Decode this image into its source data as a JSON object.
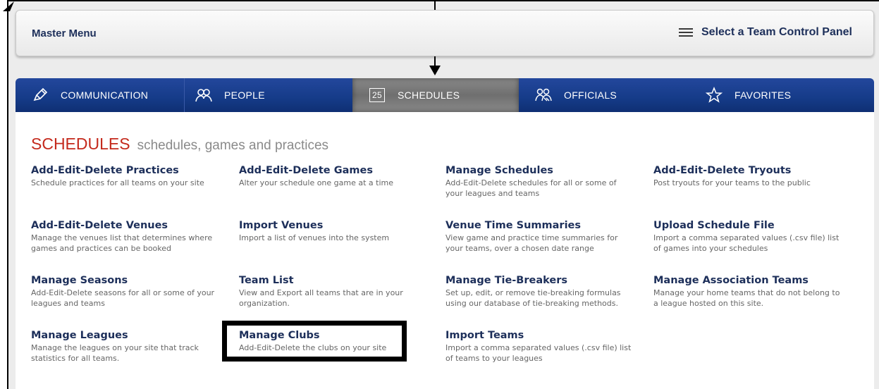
{
  "header": {
    "master_menu_label": "Master Menu",
    "team_panel_label": "Select a Team Control Panel",
    "team_panel_icon": "hamburger-menu-icon"
  },
  "nav": {
    "tabs": [
      {
        "label": "COMMUNICATION",
        "icon": "pencil-icon",
        "active": false
      },
      {
        "label": "PEOPLE",
        "icon": "people-icon",
        "active": false
      },
      {
        "label": "SCHEDULES",
        "icon": "calendar-icon",
        "calendar_day": "25",
        "active": true
      },
      {
        "label": "OFFICIALS",
        "icon": "officials-icon",
        "active": false
      },
      {
        "label": "FAVORITES",
        "icon": "star-icon",
        "active": false
      }
    ]
  },
  "section": {
    "title": "SCHEDULES",
    "subtitle": "schedules, games and practices"
  },
  "items": [
    {
      "title": "Add-Edit-Delete Practices",
      "desc": "Schedule practices for all teams on your site"
    },
    {
      "title": "Add-Edit-Delete Games",
      "desc": "Alter your schedule one game at a time"
    },
    {
      "title": "Manage Schedules",
      "desc": "Add-Edit-Delete schedules for all or some of your leagues and teams"
    },
    {
      "title": "Add-Edit-Delete Tryouts",
      "desc": "Post tryouts for your teams to the public"
    },
    {
      "title": "Add-Edit-Delete Venues",
      "desc": "Manage the venues list that determines where games and practices can be booked"
    },
    {
      "title": "Import Venues",
      "desc": "Import a list of venues into the system"
    },
    {
      "title": "Venue Time Summaries",
      "desc": "View game and practice time summaries for your teams, over a chosen date range"
    },
    {
      "title": "Upload Schedule File",
      "desc": "Import a comma separated values (.csv file) list of games into your schedules"
    },
    {
      "title": "Manage Seasons",
      "desc": "Add-Edit-Delete seasons for all or some of your leagues and teams"
    },
    {
      "title": "Team List",
      "desc": "View and Export all teams that are in your organization."
    },
    {
      "title": "Manage Tie-Breakers",
      "desc": "Set up, edit, or remove tie-breaking formulas using our database of tie-breaking methods."
    },
    {
      "title": "Manage Association Teams",
      "desc": "Manage your home teams that do not belong to a league hosted on this site."
    },
    {
      "title": "Manage Leagues",
      "desc": "Manage the leagues on your site that track statistics for all teams."
    },
    {
      "title": "Manage Clubs",
      "desc": "Add-Edit-Delete the clubs on your site"
    },
    {
      "title": "Import Teams",
      "desc": "Import a comma separated values (.csv file) list of teams to your leagues"
    }
  ]
}
